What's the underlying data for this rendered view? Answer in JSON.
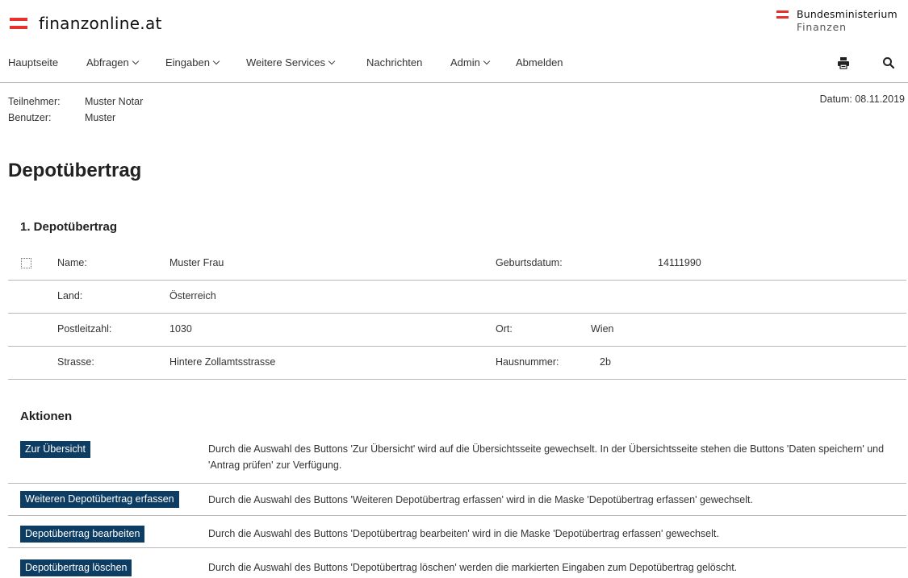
{
  "brand": {
    "name": "finanzonline.at",
    "accent": "#e6312e"
  },
  "ministry": {
    "line1": "Bundesministerium",
    "line2": "Finanzen"
  },
  "nav": {
    "items": [
      {
        "label": "Hauptseite",
        "dropdown": false
      },
      {
        "label": "Abfragen",
        "dropdown": true
      },
      {
        "label": "Eingaben",
        "dropdown": true
      },
      {
        "label": "Weitere Services",
        "dropdown": true
      },
      {
        "label": "Nachrichten",
        "dropdown": false
      },
      {
        "label": "Admin",
        "dropdown": true
      },
      {
        "label": "Abmelden",
        "dropdown": false
      }
    ],
    "icons": [
      "print-icon",
      "search-icon"
    ]
  },
  "meta": {
    "participant_label": "Teilnehmer:",
    "participant_value": "Muster Notar",
    "user_label": "Benutzer:",
    "user_value": "Muster",
    "date": "Datum: 08.11.2019"
  },
  "page": {
    "title": "Depotübertrag"
  },
  "section": {
    "title": "1. Depotübertrag",
    "checkbox_checked": false,
    "fields": {
      "name_label": "Name:",
      "name_value": "Muster Frau",
      "birth_label": "Geburtsdatum:",
      "birth_value": "14111990",
      "country_label": "Land:",
      "country_value": "Österreich",
      "zip_label": "Postleitzahl:",
      "zip_value": "1030",
      "city_label": "Ort:",
      "city_value": "Wien",
      "street_label": "Strasse:",
      "street_value": "Hintere Zollamtsstrasse",
      "house_label": "Hausnummer:",
      "house_value": "2b"
    }
  },
  "actions": {
    "title": "Aktionen",
    "button_color": "#0e3d63",
    "items": [
      {
        "label": "Zur Übersicht",
        "description": "Durch die Auswahl des Buttons 'Zur Übersicht' wird auf die Übersichtsseite gewechselt. In der Übersichtsseite stehen die Buttons 'Daten speichern' und 'Antrag prüfen' zur Verfügung."
      },
      {
        "label": "Weiteren Depotübertrag erfassen",
        "description": "Durch die Auswahl des Buttons 'Weiteren Depotübertrag erfassen' wird in die Maske 'Depotübertrag erfassen' gewechselt."
      },
      {
        "label": "Depotübertrag bearbeiten",
        "description": "Durch die Auswahl des Buttons 'Depotübertrag bearbeiten' wird in die Maske 'Depotübertrag erfassen' gewechselt."
      },
      {
        "label": "Depotübertrag löschen",
        "description": "Durch die Auswahl des Buttons 'Depotübertrag löschen' werden die markierten Eingaben zum Depotübertrag gelöscht."
      }
    ]
  }
}
